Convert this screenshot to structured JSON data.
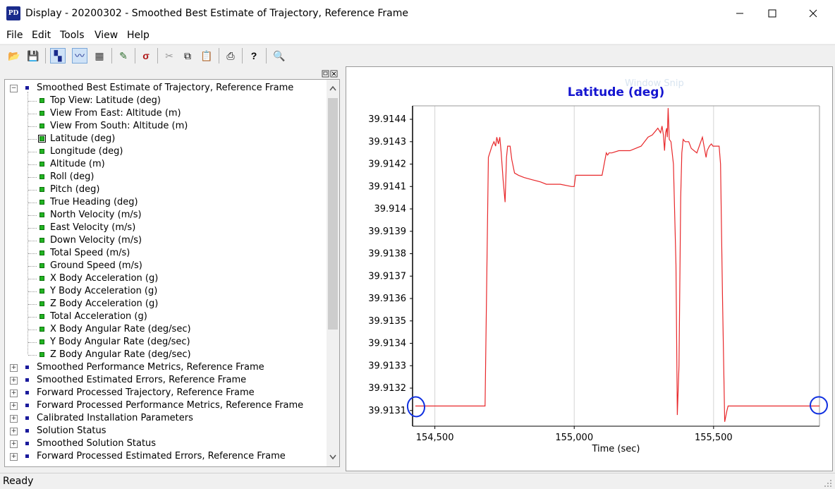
{
  "window": {
    "title": "Display - 20200302 - Smoothed Best Estimate of Trajectory, Reference Frame",
    "app_icon_text": "PD",
    "minimize_icon": "minimize-icon",
    "maximize_icon": "maximize-icon",
    "close_icon": "close-icon"
  },
  "menu": [
    "File",
    "Edit",
    "Tools",
    "View",
    "Help"
  ],
  "toolbar": {
    "buttons": [
      {
        "name": "open-icon",
        "glyph": "📂"
      },
      {
        "name": "save-icon",
        "glyph": "💾"
      },
      {
        "name": "tree-view-icon",
        "glyph": "▚"
      },
      {
        "name": "plot-icon",
        "glyph": "〰"
      },
      {
        "name": "table-icon",
        "glyph": "▦"
      },
      {
        "name": "pencil-icon",
        "glyph": "✎"
      },
      {
        "name": "sigma-icon",
        "glyph": "σ"
      },
      {
        "name": "cut-icon",
        "glyph": "✂"
      },
      {
        "name": "copy-icon",
        "glyph": "⧉"
      },
      {
        "name": "paste-icon",
        "glyph": "📋"
      },
      {
        "name": "print-icon",
        "glyph": "⎙"
      },
      {
        "name": "help-icon",
        "glyph": "?"
      },
      {
        "name": "zoom-icon",
        "glyph": "🔍"
      }
    ]
  },
  "tree": {
    "root": "Smoothed Best Estimate of Trajectory, Reference Frame",
    "children": [
      "Top View: Latitude (deg)",
      "View From East: Altitude (m)",
      "View From South: Altitude (m)",
      "Latitude (deg)",
      "Longitude (deg)",
      "Altitude (m)",
      "Roll (deg)",
      "Pitch (deg)",
      "True Heading (deg)",
      "North Velocity (m/s)",
      "East Velocity (m/s)",
      "Down Velocity (m/s)",
      "Total Speed (m/s)",
      "Ground Speed (m/s)",
      "X Body Acceleration (g)",
      "Y Body Acceleration (g)",
      "Z Body Acceleration (g)",
      "Total Acceleration (g)",
      "X Body Angular Rate (deg/sec)",
      "Y Body Angular Rate (deg/sec)",
      "Z Body Angular Rate (deg/sec)"
    ],
    "selected_index": 3,
    "collapsed_nodes": [
      "Smoothed Performance Metrics, Reference Frame",
      "Smoothed Estimated Errors, Reference Frame",
      "Forward Processed Trajectory, Reference Frame",
      "Forward Processed Performance Metrics, Reference Frame",
      "Calibrated Installation Parameters",
      "Solution Status",
      "Smoothed Solution Status",
      "Forward Processed Estimated Errors, Reference Frame"
    ]
  },
  "watermark": "Window Snip",
  "status": "Ready",
  "chart_data": {
    "type": "line",
    "title": "Latitude (deg)",
    "xlabel": "Time (sec)",
    "ylabel": "",
    "xlim": [
      154420,
      155880
    ],
    "ylim": [
      39.91303,
      39.91446
    ],
    "x_ticks": [
      154500,
      155000,
      155500
    ],
    "x_tick_labels": [
      "154,500",
      "155,000",
      "155,500"
    ],
    "y_ticks": [
      39.9131,
      39.9132,
      39.9133,
      39.9134,
      39.9135,
      39.9136,
      39.9137,
      39.9138,
      39.9139,
      39.914,
      39.9141,
      39.9142,
      39.9143,
      39.9144
    ],
    "y_tick_labels": [
      "39.9131",
      "39.9132",
      "39.9133",
      "39.9134",
      "39.9135",
      "39.9136",
      "39.9137",
      "39.9138",
      "39.9139",
      "39.914",
      "39.9141",
      "39.9142",
      "39.9143",
      "39.9144"
    ],
    "grid": "vertical",
    "line_color": "#e8282b",
    "annotation_color": "#1030e0",
    "series": [
      {
        "x": [
          154430,
          154680,
          154692,
          154705,
          154712,
          154718,
          154722,
          154728,
          154733,
          154738,
          154745,
          154752,
          154757,
          154761,
          154765,
          154770,
          154776,
          154786,
          154800,
          154820,
          154850,
          154880,
          154900,
          154920,
          154950,
          154990,
          154996,
          155000,
          155005,
          155010,
          155020,
          155050,
          155100,
          155115,
          155120,
          155125,
          155135,
          155160,
          155200,
          155240,
          155265,
          155280,
          155300,
          155310,
          155315,
          155320,
          155324,
          155328,
          155332,
          155334,
          155337,
          155341,
          155347,
          155356,
          155365,
          155370,
          155376,
          155382,
          155386,
          155391,
          155398,
          155404,
          155411,
          155420,
          155440,
          155460,
          155470,
          155473,
          155477,
          155485,
          155492,
          155498,
          155510,
          155520,
          155525,
          155532,
          155540,
          155548,
          155552,
          155558,
          155580,
          155700,
          155880
        ],
        "y": [
          39.91312,
          39.91312,
          39.91423,
          39.91428,
          39.9143,
          39.91428,
          39.91432,
          39.91429,
          39.91432,
          39.91425,
          39.91413,
          39.91403,
          39.91423,
          39.91428,
          39.91428,
          39.91428,
          39.91422,
          39.91416,
          39.91415,
          39.91414,
          39.91413,
          39.91412,
          39.91411,
          39.91411,
          39.91411,
          39.9141,
          39.9141,
          39.9141,
          39.91415,
          39.91415,
          39.91415,
          39.91415,
          39.91415,
          39.91425,
          39.91424,
          39.91425,
          39.91425,
          39.91426,
          39.91426,
          39.91428,
          39.91432,
          39.91433,
          39.91436,
          39.91434,
          39.91437,
          39.91433,
          39.91426,
          39.91434,
          39.91436,
          39.91432,
          39.91445,
          39.91431,
          39.9143,
          39.9142,
          39.91375,
          39.91308,
          39.9133,
          39.91405,
          39.91425,
          39.91431,
          39.9143,
          39.9143,
          39.9143,
          39.91427,
          39.91425,
          39.91432,
          39.91425,
          39.91423,
          39.91426,
          39.91428,
          39.91429,
          39.91428,
          39.91428,
          39.91428,
          39.9142,
          39.9136,
          39.91305,
          39.9131,
          39.91312,
          39.91312,
          39.91312,
          39.91312,
          39.91312
        ]
      }
    ]
  }
}
